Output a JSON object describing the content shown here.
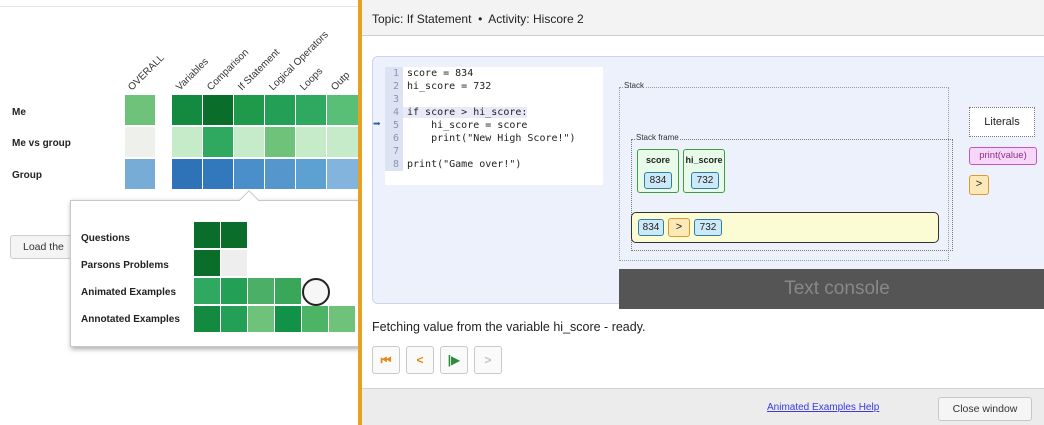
{
  "grid": {
    "columns": [
      "OVERALL",
      "Variables",
      "Comparison",
      "If Statement",
      "Logical Operators",
      "Loops",
      "Outp"
    ],
    "rows": [
      {
        "label": "Me",
        "colors": [
          "#6fc27a",
          "#148a40",
          "#0a6e2a",
          "#1f9a4a",
          "#23a055",
          "#2ea95f",
          "#5abf76"
        ]
      },
      {
        "label": "Me vs group",
        "colors": [
          "#eef0ec",
          "#c6ebc8",
          "#2ea95f",
          "#c6ebc8",
          "#6fc27a",
          "#c6ebc8",
          "#c6ebc8"
        ]
      },
      {
        "label": "Group",
        "colors": [
          "#76acd6",
          "#2e72b8",
          "#3179bc",
          "#4b8fca",
          "#5596cc",
          "#5da0d2",
          "#82b4dd"
        ]
      }
    ]
  },
  "load_button_label": "Load the",
  "popup": {
    "rows": [
      {
        "label": "Questions",
        "colors": [
          "#0a6e2a",
          "#0a6e2a"
        ]
      },
      {
        "label": "Parsons Problems",
        "colors": [
          "#0a6e2a",
          "#eeeeee"
        ]
      },
      {
        "label": "Animated Examples",
        "colors": [
          "#2ea95f",
          "#23a055",
          "#4caf68",
          "#3aa65a"
        ]
      },
      {
        "label": "Annotated Examples",
        "colors": [
          "#148a40",
          "#23a055",
          "#6fc27a",
          "#129149",
          "#4db365",
          "#6fc27a"
        ]
      }
    ]
  },
  "window": {
    "topic_label": "Topic:",
    "topic": "If Statement",
    "separator": "•",
    "activity_label": "Activity:",
    "activity": "Hiscore 2",
    "code": [
      {
        "n": "1",
        "text": "score = 834"
      },
      {
        "n": "2",
        "text": "hi_score = 732"
      },
      {
        "n": "3",
        "text": ""
      },
      {
        "n": "4",
        "text": "if score > hi_score:"
      },
      {
        "n": "5",
        "text": "    hi_score = score"
      },
      {
        "n": "6",
        "text": "    print(\"New High Score!\")"
      },
      {
        "n": "7",
        "text": ""
      },
      {
        "n": "8",
        "text": "print(\"Game over!\")"
      }
    ],
    "stack_label": "Stack",
    "frame_label": "Stack frame",
    "variables": [
      {
        "name": "score",
        "value": "834"
      },
      {
        "name": "hi_score",
        "value": "732"
      }
    ],
    "expression": {
      "left": "834",
      "op": ">",
      "right": "732"
    },
    "literals_label": "Literals",
    "literals": [
      "print(value)",
      ">"
    ],
    "console_label": "Text console",
    "status": "Fetching value from the variable hi_score - ready.",
    "nav_icons": [
      "first-step-icon",
      "previous-step-icon",
      "next-step-icon",
      "last-step-icon"
    ],
    "help_link": "Animated Examples Help",
    "close_button": "Close window"
  }
}
